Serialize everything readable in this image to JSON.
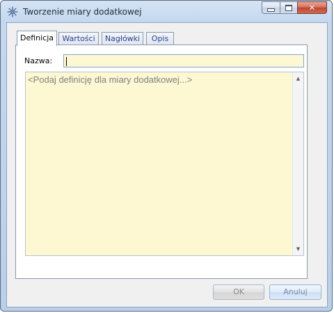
{
  "window": {
    "title": "Tworzenie miary dodatkowej",
    "icon": "snowflake-icon",
    "caption_buttons": [
      "minimize-icon",
      "maximize-icon",
      "close-icon"
    ]
  },
  "tabs": [
    {
      "label": "Definicja",
      "active": true
    },
    {
      "label": "Wartości",
      "active": false
    },
    {
      "label": "Nagłówki",
      "active": false
    },
    {
      "label": "Opis",
      "active": false
    }
  ],
  "form": {
    "name_label": "Nazwa:",
    "name_value": "",
    "definition_placeholder": "<Podaj definicję dla miary dodatkowej...>"
  },
  "buttons": {
    "ok": "OK",
    "cancel": "Anuluj"
  },
  "colors": {
    "input_background": "#fdf8d2",
    "close_button": "#c2452e",
    "active_tab_text": "#000000",
    "inactive_tab_text": "#2a3f8a"
  }
}
